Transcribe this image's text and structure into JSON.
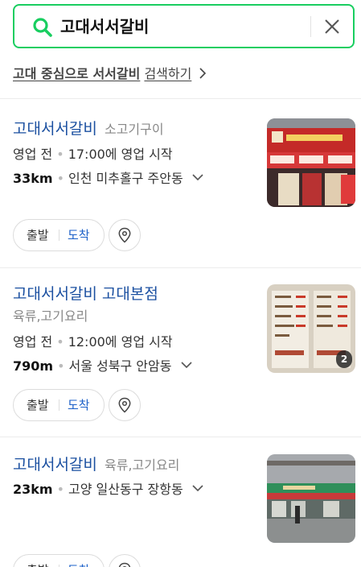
{
  "search": {
    "query": "고대서서갈비"
  },
  "suggestion": {
    "query": "고대 중심으로 서서갈비",
    "action": "검색하기"
  },
  "colors": {
    "accent": "#19ce60",
    "link": "#1a4fa0",
    "arrive": "#1a5fc8"
  },
  "results": [
    {
      "name": "고대서서갈비",
      "category": "소고기구이",
      "status": "영업 전",
      "hours": "17:00에 영업 시작",
      "distance": "33km",
      "address": "인천 미추홀구 주안동",
      "depart_label": "출발",
      "arrive_label": "도착",
      "thumbnail": "restaurant-storefront-photo"
    },
    {
      "name": "고대서서갈비 고대본점",
      "category": "육류,고기요리",
      "status": "영업 전",
      "hours": "12:00에 영업 시작",
      "distance": "790m",
      "address": "서울 성북구 안암동",
      "photo_count": "2",
      "depart_label": "출발",
      "arrive_label": "도착",
      "thumbnail": "menu-board-photo"
    },
    {
      "name": "고대서서갈비",
      "category": "육류,고기요리",
      "distance": "23km",
      "address": "고양 일산동구 장항동",
      "depart_label": "출발",
      "arrive_label": "도착",
      "thumbnail": "street-storefront-photo"
    }
  ]
}
